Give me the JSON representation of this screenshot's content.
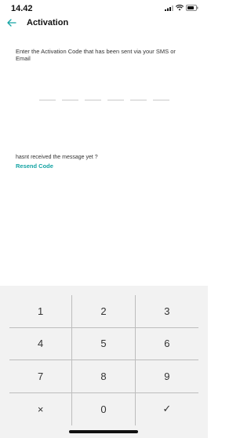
{
  "status_bar": {
    "time": "14.42",
    "icons": [
      "signal-icon",
      "wifi-icon",
      "battery-icon"
    ]
  },
  "header": {
    "title": "Activation",
    "back_icon": "back-arrow-icon"
  },
  "instruction": "Enter the Activation Code that has been sent via your SMS or Email",
  "code_input": {
    "slots": [
      "",
      "",
      "",
      "",
      "",
      ""
    ]
  },
  "hint_text": "hasnt received the message yet ?",
  "resend_label": "Resend Code",
  "keypad": {
    "keys": [
      [
        "1",
        "2",
        "3"
      ],
      [
        "4",
        "5",
        "6"
      ],
      [
        "7",
        "8",
        "9"
      ],
      [
        "×",
        "0",
        "✓"
      ]
    ]
  },
  "colors": {
    "accent": "#14a3a3",
    "keypad_bg": "#f2f2f2"
  }
}
